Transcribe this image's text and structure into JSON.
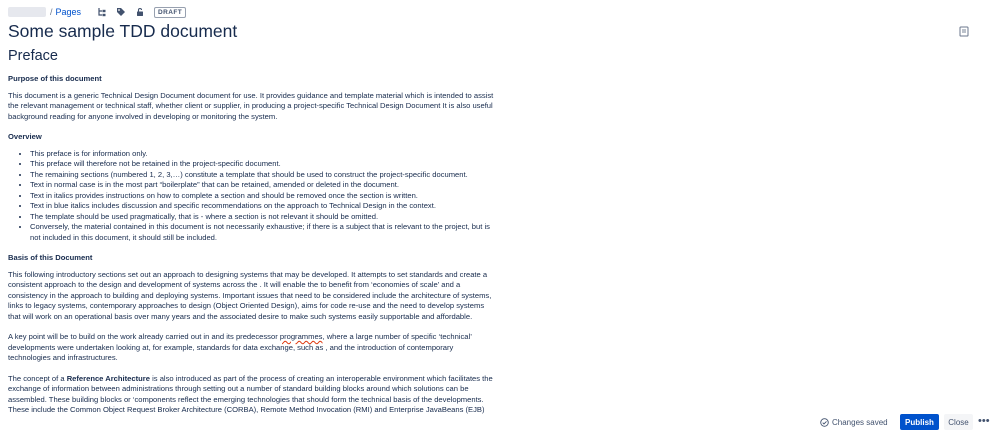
{
  "breadcrumb": {
    "separator": "/",
    "pages_label": "Pages"
  },
  "toolbar": {
    "draft_badge": "DRAFT"
  },
  "page": {
    "title": "Some sample TDD document"
  },
  "content": {
    "heading": "Preface",
    "purpose": {
      "heading": "Purpose of this document",
      "text": "This document is a generic Technical Design Document document for use. It provides guidance and template material which is intended to assist the relevant management or technical staff, whether client or supplier, in producing a project-specific Technical Design Document It is also useful background reading for anyone involved in developing or monitoring the system."
    },
    "overview": {
      "heading": "Overview",
      "items": [
        "This preface is for information only.",
        "This preface will therefore not be retained in the project-specific document.",
        "The remaining sections (numbered 1, 2, 3,…) constitute a template that should be used to construct the project-specific document.",
        "Text in normal case is in the most part “boilerplate” that can be retained, amended or deleted in the document.",
        "Text in italics provides instructions on how to complete a section and should be removed once the section is written.",
        "Text in blue italics includes discussion and specific recommendations on the approach to Technical Design in the  context.",
        "The template should be used pragmatically, that is - where a section is not relevant it should be omitted.",
        "Conversely, the material contained in this document is not necessarily exhaustive; if there is a subject that is relevant to the project, but is not included in this document, it should still be included."
      ]
    },
    "basis": {
      "heading": "Basis of this Document",
      "p1": "This following introductory sections set out an approach to designing systems that may be developed. It attempts to set standards and create a consistent approach to the design and development of systems across the  . It will enable the  to benefit from ‘economies of scale’ and a consistency in the approach to building and deploying systems. Important issues that need to be considered include the architecture of systems, links to legacy systems, contemporary approaches to design (Object Oriented Design), aims for code re-use and the need to develop systems that will work on an operational basis over many years and the associated desire to make such systems easily supportable and affordable.",
      "p2_a": "A key point will be to build on the work already carried out in  and its predecessor ",
      "p2_spell": "programmes",
      "p2_b": ", where a large number of specific ‘technical’ developments were undertaken looking at, for example, standards for data exchange, such as , and the introduction of contemporary technologies and infrastructures.",
      "p3_a": "The concept of a ",
      "p3_bold": "Reference Architecture",
      "p3_b": " is also introduced as part of the process of creating an interoperable environment which facilitates the exchange of information between administrations through setting out a number of standard building blocks around which solutions can be assembled. These building blocks or ‘components reflect the emerging technologies that should form the technical basis of the  developments. These include the Common Object Request Broker Architecture (CORBA), Remote Method Invocation (RMI) and Enterprise JavaBeans (EJB)"
    }
  },
  "footer": {
    "status": "Changes saved",
    "publish": "Publish",
    "close": "Close",
    "more": "•••"
  }
}
